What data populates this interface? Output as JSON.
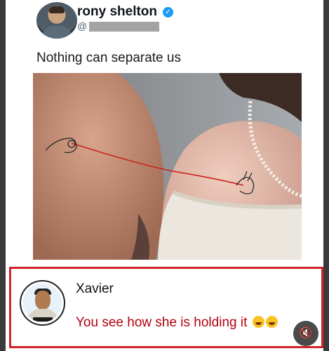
{
  "post": {
    "author_name": "rony shelton",
    "handle_prefix": "@",
    "text": "Nothing can separate us"
  },
  "comment": {
    "author_name": "Xavier",
    "text": "You see how she is holding it",
    "emojis": [
      "rolling-on-floor-laughing-emoji",
      "rolling-on-floor-laughing-emoji"
    ],
    "highlight_color": "#d1232a"
  },
  "icons": {
    "verified": "verified-badge-icon",
    "mute": "speaker-muted-icon",
    "mute_glyph": "🔇"
  }
}
